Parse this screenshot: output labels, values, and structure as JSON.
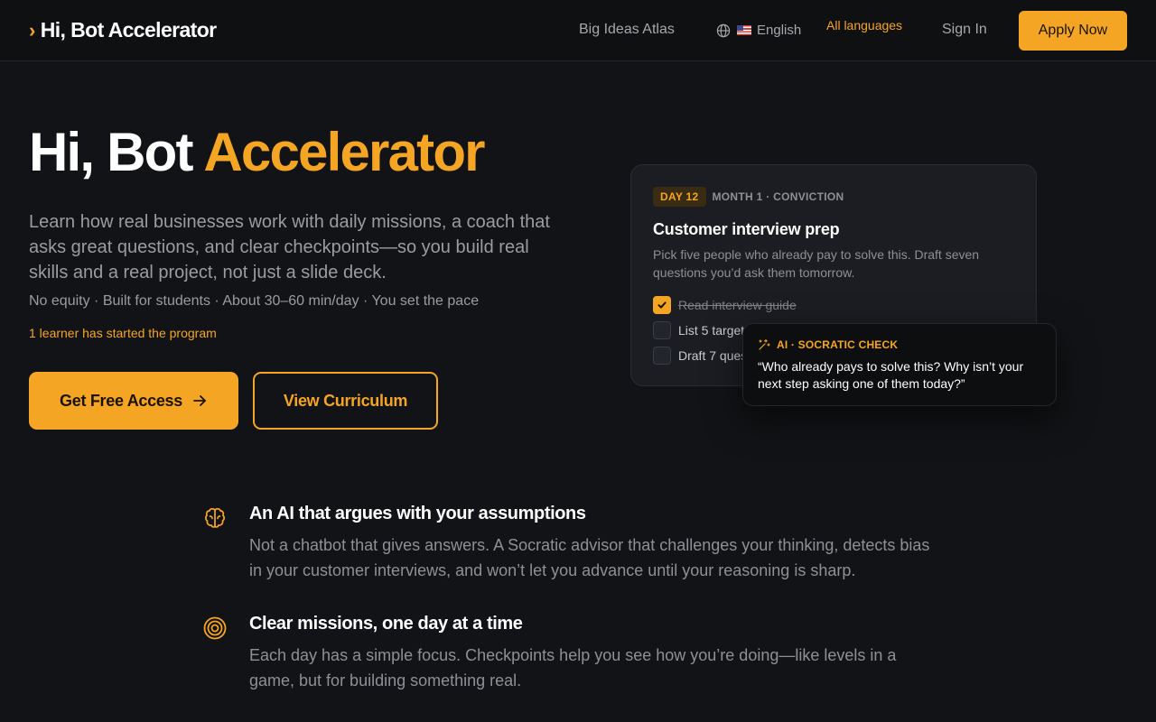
{
  "nav": {
    "brand": "Hi, Bot Accelerator",
    "brand_chevron": "›",
    "atlas_link": "Big Ideas Atlas",
    "language": "English",
    "language_icon": "globe-icon",
    "flag": "us-flag-icon",
    "all_languages": "All languages",
    "sign_in": "Sign In",
    "apply": "Apply Now"
  },
  "hero": {
    "title_main": "Hi, Bot",
    "title_accent": "Accelerator",
    "description": "Learn how real businesses work with daily missions, a coach that asks great questions, and clear checkpoints—so you build real skills and a real project, not just a slide deck.",
    "meta": "No equity · Built for students · About 30–60 min/day · You set the pace",
    "learner_count": "1 learner has started the program",
    "primary_cta": "Get Free Access",
    "secondary_cta": "View Curriculum"
  },
  "mission_card": {
    "day_badge": "DAY 12",
    "month": "MONTH 1 · CONVICTION",
    "title": "Customer interview prep",
    "description": "Pick five people who already pay to solve this. Draft seven questions you’d ask them tomorrow.",
    "todos": [
      {
        "label": "Read interview guide",
        "checked": true
      },
      {
        "label": "List 5 targets",
        "checked": false
      },
      {
        "label": "Draft 7 questions",
        "checked": false
      }
    ]
  },
  "socratic": {
    "label": "AI · SOCRATIC CHECK",
    "text": "“Who already pays to solve this? Why isn’t your next step asking one of them today?”"
  },
  "features": [
    {
      "icon": "brain-icon",
      "title": "An AI that argues with your assumptions",
      "text": "Not a chatbot that gives answers. A Socratic advisor that challenges your thinking, detects bias in your customer interviews, and won’t let you advance until your reasoning is sharp."
    },
    {
      "icon": "target-icon",
      "title": "Clear missions, one day at a time",
      "text": "Each day has a simple focus. Checkpoints help you see how you’re doing—like levels in a game, but for building something real."
    }
  ],
  "colors": {
    "accent": "#f5a524",
    "background": "#121316",
    "card": "#1b1d22"
  }
}
